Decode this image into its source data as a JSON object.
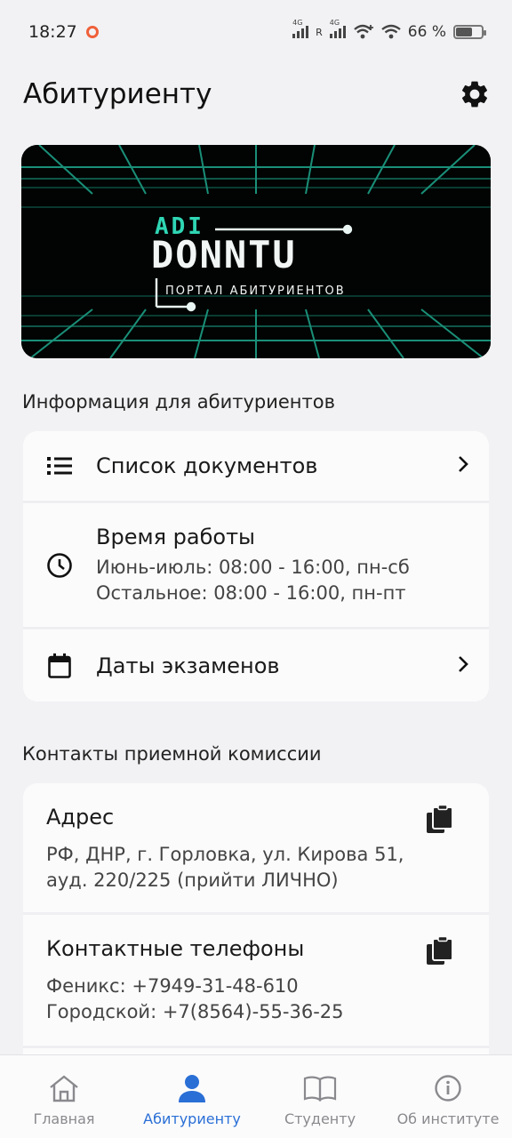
{
  "status_bar": {
    "time": "18:27",
    "battery_text": "66 %",
    "battery_level": 0.66,
    "network_1": "4G",
    "network_2": "4G",
    "roaming": "R"
  },
  "header": {
    "title": "Абитуриенту",
    "settings_icon": "gear-icon"
  },
  "banner": {
    "logo_top": "ADI",
    "logo_main": "DONNTU",
    "logo_sub": "ПОРТАЛ АБИТУРИЕНТОВ",
    "accent_color": "#2fd6b4"
  },
  "info_section": {
    "title": "Информация для абитуриентов",
    "documents_label": "Список документов",
    "hours_label": "Время работы",
    "hours_summer": "Июнь-июль: 08:00 - 16:00, пн-сб",
    "hours_rest": "Остальное: 08:00 - 16:00, пн-пт",
    "exams_label": "Даты экзаменов"
  },
  "contacts_section": {
    "title": "Контакты приемной комиссии",
    "address_title": "Адрес",
    "address_line1": "РФ, ДНР, г. Горловка, ул. Кирова 51,",
    "address_line2": "ауд. 220/225 (прийти ЛИЧНО)",
    "phones_title": "Контактные телефоны",
    "phone_1": "Феникс: +7949-31-48-610",
    "phone_2": "Городской: +7(8564)-55-36-25"
  },
  "bottom_nav": {
    "home": "Главная",
    "applicant": "Абитуриенту",
    "student": "Студенту",
    "about": "Об институте",
    "active_color": "#2a6fd6"
  }
}
